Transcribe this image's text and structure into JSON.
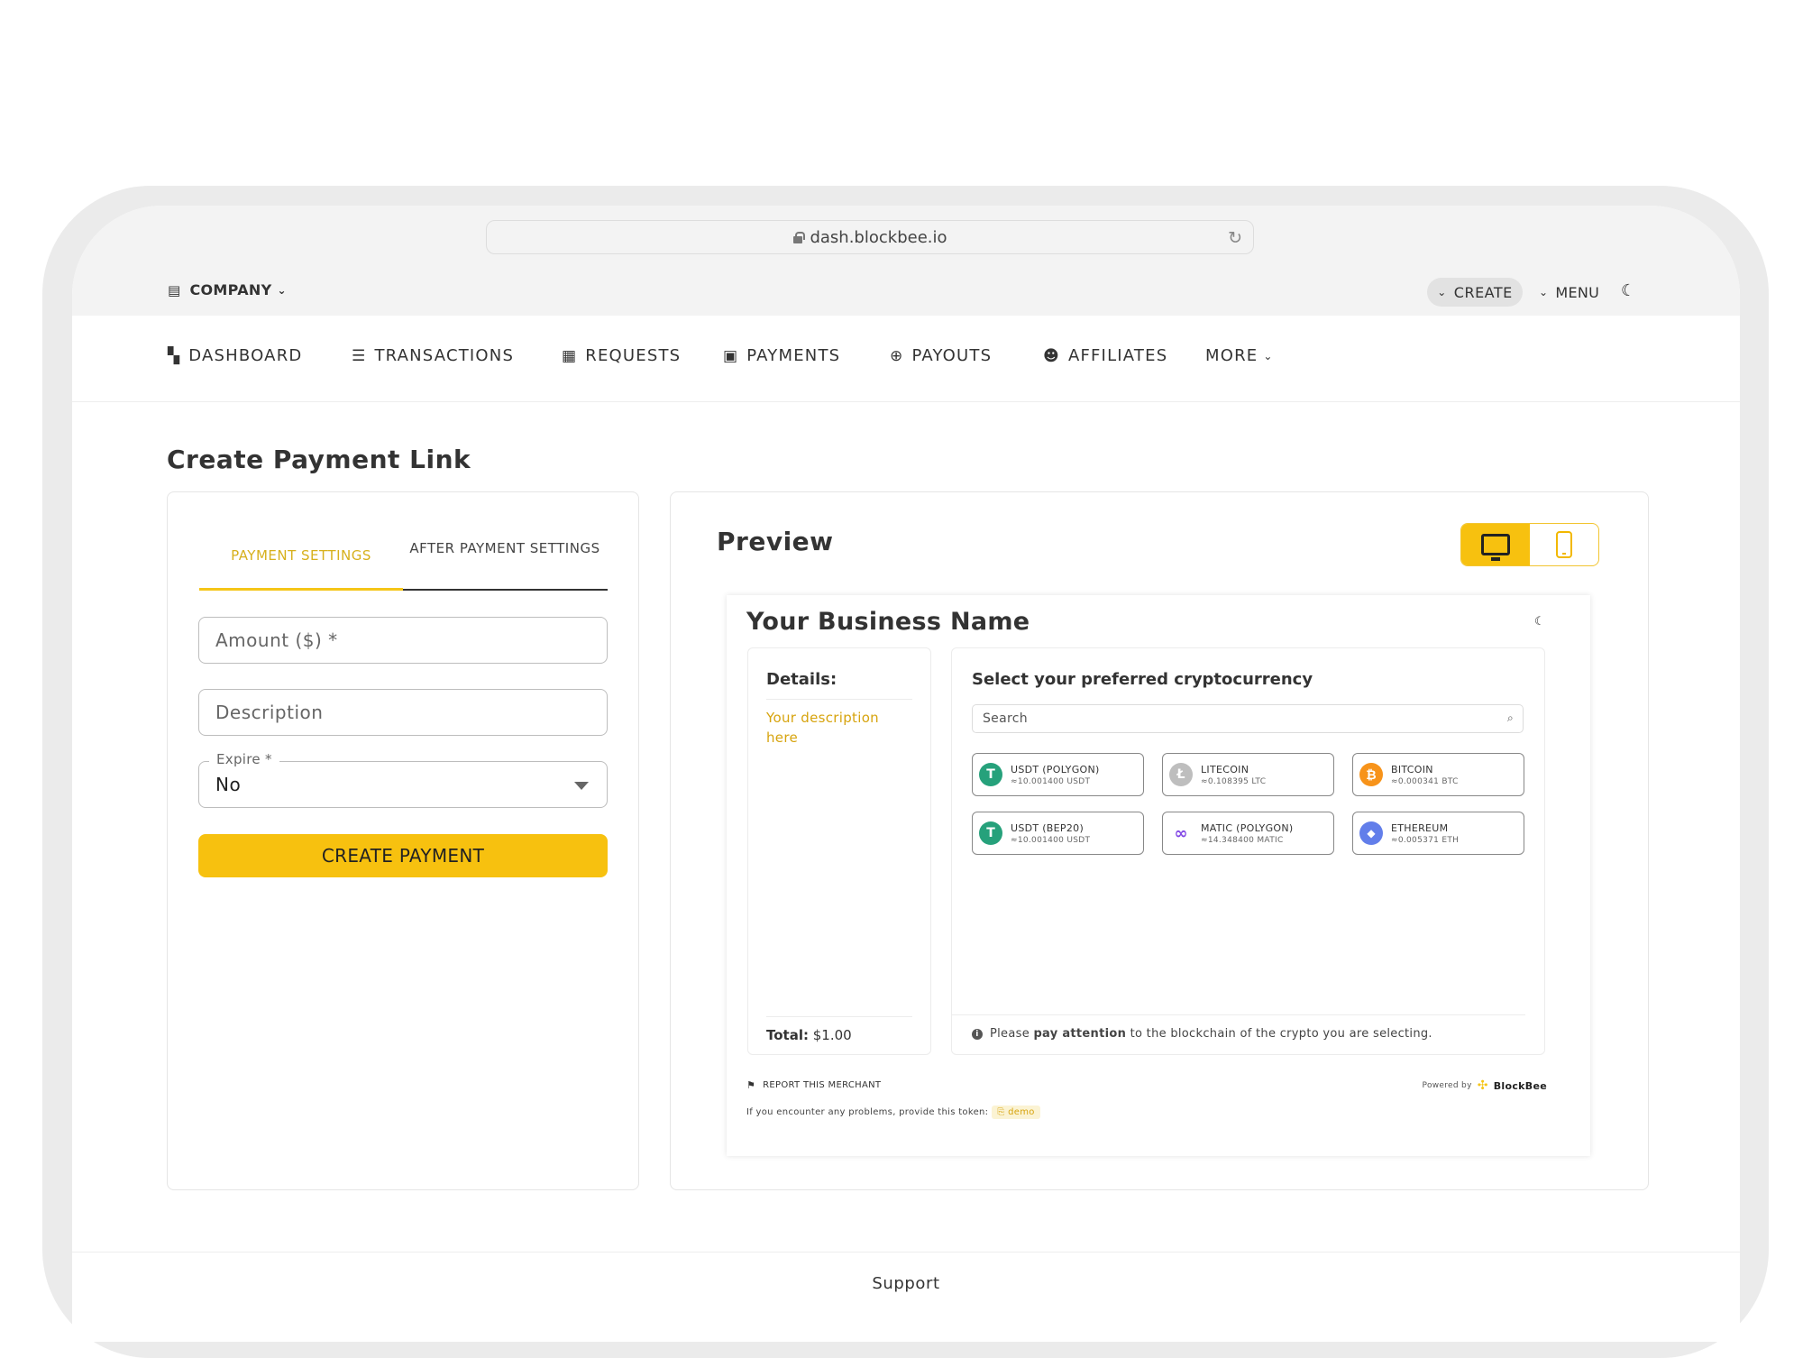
{
  "browser": {
    "url": "dash.blockbee.io"
  },
  "header": {
    "company_label": "COMPANY",
    "create_label": "CREATE",
    "menu_label": "MENU"
  },
  "nav": {
    "items": [
      {
        "label": "DASHBOARD",
        "icon": "dashboard-icon"
      },
      {
        "label": "TRANSACTIONS",
        "icon": "list-icon"
      },
      {
        "label": "REQUESTS",
        "icon": "receipt-icon"
      },
      {
        "label": "PAYMENTS",
        "icon": "payments-icon"
      },
      {
        "label": "PAYOUTS",
        "icon": "payout-icon"
      },
      {
        "label": "AFFILIATES",
        "icon": "group-icon"
      },
      {
        "label": "MORE",
        "icon": "chevron-down-icon"
      }
    ]
  },
  "page": {
    "title": "Create Payment Link"
  },
  "form": {
    "tabs": [
      "PAYMENT SETTINGS",
      "AFTER PAYMENT SETTINGS"
    ],
    "amount_placeholder": "Amount ($) *",
    "description_placeholder": "Description",
    "expire_label": "Expire *",
    "expire_value": "No",
    "submit_label": "CREATE PAYMENT"
  },
  "preview": {
    "title": "Preview",
    "business_name": "Your Business Name",
    "details_title": "Details:",
    "description": "Your description here",
    "total_label": "Total:",
    "total_value": "$1.00",
    "crypto_title": "Select your preferred cryptocurrency",
    "search_placeholder": "Search",
    "coins": [
      {
        "name": "USDT (POLYGON)",
        "amount": "≈10.001400 USDT",
        "color": "#26a17b",
        "glyph": "T"
      },
      {
        "name": "LITECOIN",
        "amount": "≈0.108395 LTC",
        "color": "#bebebe",
        "glyph": "Ł"
      },
      {
        "name": "BITCOIN",
        "amount": "≈0.000341 BTC",
        "color": "#f7931a",
        "glyph": "₿"
      },
      {
        "name": "USDT (BEP20)",
        "amount": "≈10.001400 USDT",
        "color": "#26a17b",
        "glyph": "T"
      },
      {
        "name": "MATIC (POLYGON)",
        "amount": "≈14.348400 MATIC",
        "color": "#8247e5",
        "glyph": "∞"
      },
      {
        "name": "ETHEREUM",
        "amount": "≈0.005371 ETH",
        "color": "#627eea",
        "glyph": "◆"
      }
    ],
    "notice_prefix": "Please ",
    "notice_bold": "pay attention",
    "notice_suffix": " to the blockchain of the crypto you are selecting.",
    "report_label": "REPORT THIS MERCHANT",
    "powered_by": "Powered by",
    "brand": "BlockBee",
    "token_text": "If you encounter any problems, provide this token:",
    "token_value": "demo"
  },
  "footer": {
    "support_label": "Support"
  }
}
